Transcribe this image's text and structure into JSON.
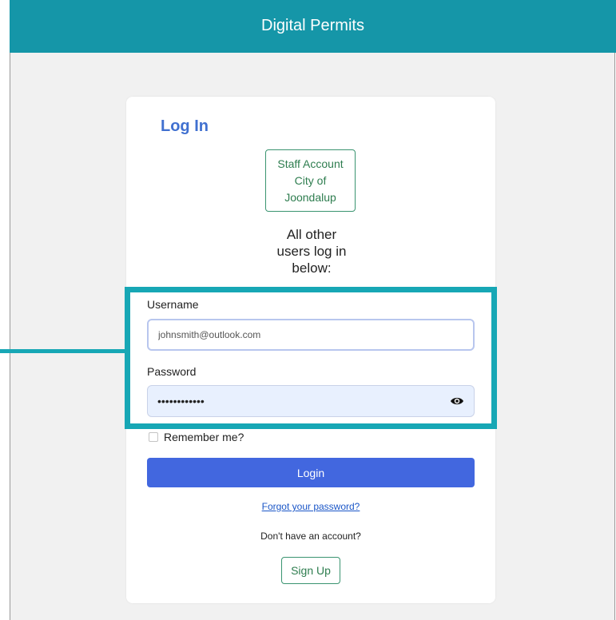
{
  "header": {
    "title": "Digital Permits"
  },
  "login": {
    "title": "Log In",
    "staff_account": {
      "line1": "Staff Account",
      "line2": "City of",
      "line3": "Joondalup"
    },
    "other_users": {
      "line1": "All other",
      "line2": "users log in",
      "line3": "below:"
    },
    "username": {
      "label": "Username",
      "value": "johnsmith@outlook.com"
    },
    "password": {
      "label": "Password",
      "value": "••••••••••••"
    },
    "remember_me": {
      "label": "Remember me?",
      "checked": false
    },
    "login_button": "Login",
    "forgot_password": "Forgot your password?",
    "no_account": "Don't have an account?",
    "signup_button": "Sign Up"
  },
  "icons": {
    "eye": "eye-icon"
  },
  "colors": {
    "header": "#1596a8",
    "highlight": "#17a7b5",
    "primary": "#4267df",
    "link": "#1a56c7",
    "title": "#4070d0",
    "secondary": "#2e7d4f"
  }
}
